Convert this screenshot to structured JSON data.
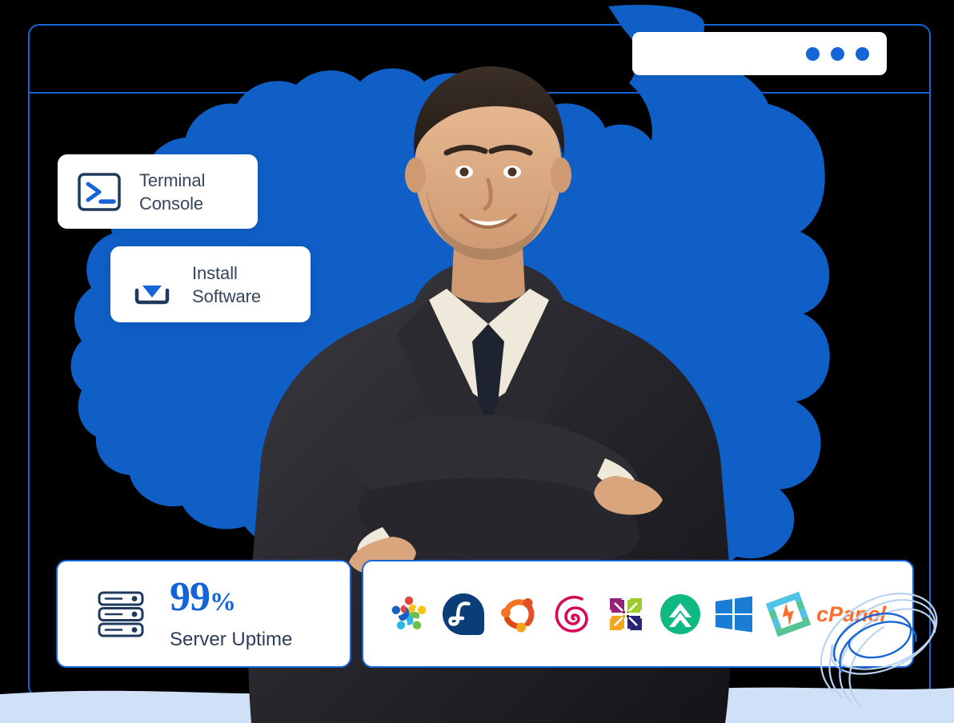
{
  "window": {
    "frame_name": "browser-window-frame",
    "controls": [
      {
        "name": "window-dot-1"
      },
      {
        "name": "window-dot-2"
      },
      {
        "name": "window-dot-3"
      }
    ]
  },
  "colors": {
    "brand_blue": "#1565D8",
    "brush_blue": "#0F5FC6",
    "navy_text": "#2C3E58",
    "slate_text": "#35455C",
    "ground_blue": "#CFE0F7",
    "card_white": "#FFFFFF"
  },
  "cards": {
    "terminal": {
      "label": "Terminal\nConsole",
      "icon": "terminal-console-icon"
    },
    "install": {
      "label": "Install\nSoftware",
      "icon": "install-software-icon"
    },
    "uptime": {
      "value": "99",
      "symbol": "%",
      "caption": "Server Uptime",
      "icon": "server-rack-icon"
    }
  },
  "os_logos": [
    {
      "name": "almalinux-logo",
      "label": "AlmaLinux"
    },
    {
      "name": "fedora-logo",
      "label": "Fedora"
    },
    {
      "name": "ubuntu-logo",
      "label": "Ubuntu"
    },
    {
      "name": "debian-logo",
      "label": "Debian"
    },
    {
      "name": "centos-logo",
      "label": "CentOS"
    },
    {
      "name": "rockylinux-logo",
      "label": "Rocky Linux"
    },
    {
      "name": "windows-logo",
      "label": "Windows"
    },
    {
      "name": "cpanel-logo",
      "label": "cPanel"
    }
  ],
  "person": {
    "name": "businessman-photo",
    "alt": "Smiling businessman in dark suit with arms crossed"
  }
}
